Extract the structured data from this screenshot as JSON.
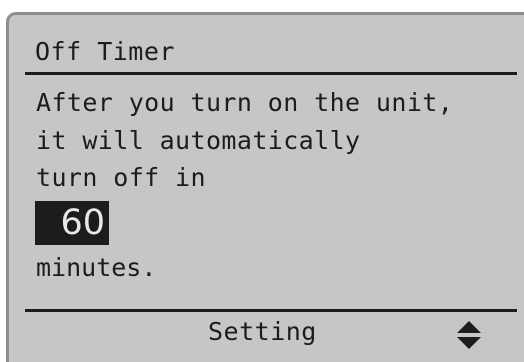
{
  "screen": {
    "title": "Off Timer",
    "body_lines": [
      "After you turn on the unit,",
      "it will automatically",
      "turn off in"
    ],
    "timer_value": "60",
    "unit": "minutes.",
    "footer": {
      "label": "Setting",
      "icon": "up-down-arrows-icon"
    }
  },
  "colors": {
    "lcd_background": "#c6c6c6",
    "lcd_text": "#1c1c1c",
    "highlight_text": "#e8e8e8"
  }
}
